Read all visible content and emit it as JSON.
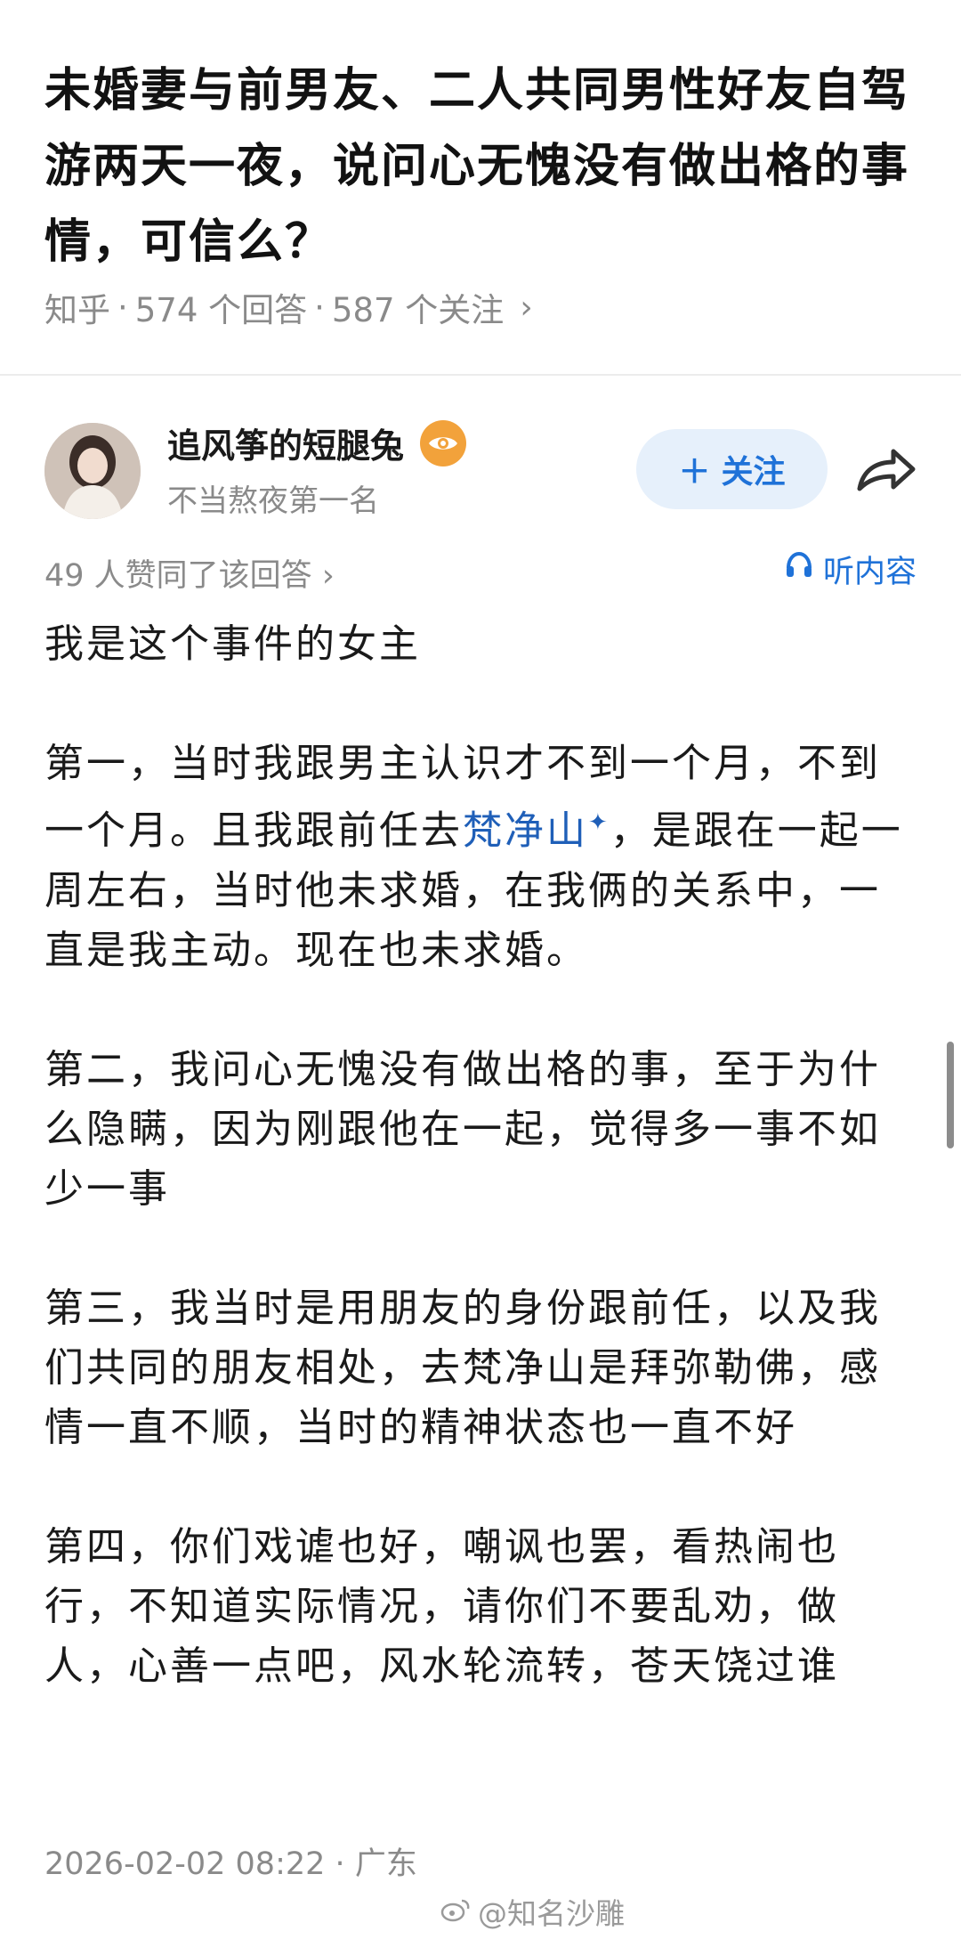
{
  "question": {
    "title": "未婚妻与前男友、二人共同男性好友自驾游两天一夜，说问心无愧没有做出格的事情，可信么？",
    "source": "知乎",
    "answer_count": "574 个回答",
    "follow_count": "587 个关注",
    "separator": "·"
  },
  "author": {
    "name": "追风筝的短腿兔",
    "bio": "不当熬夜第一名",
    "badge_icon": "eye-badge-icon",
    "follow_label": "关注"
  },
  "answer": {
    "votes": "49 人赞同了该回答",
    "listen_label": "听内容",
    "paragraphs": {
      "p1": "我是这个事件的女主",
      "p2_before": "第一，当时我跟男主认识才不到一个月，不到一个月。且我跟前任去",
      "p2_link": "梵净山",
      "p2_after": "，是跟在一起一周左右，当时他未求婚，在我俩的关系中，一直是我主动。现在也未求婚。",
      "p3": "第二，我问心无愧没有做出格的事，至于为什么隐瞒，因为刚跟他在一起，觉得多一事不如少一事",
      "p4": "第三，我当时是用朋友的身份跟前任，以及我们共同的朋友相处，去梵净山是拜弥勒佛，感情一直不顺，当时的精神状态也一直不好",
      "p5": "第四，你们戏谑也好，嘲讽也罢，看热闹也行，不知道实际情况，请你们不要乱劝，做人，心善一点吧，风水轮流转，苍天饶过谁"
    },
    "time": "2026-02-02 08:22",
    "location": "广东"
  },
  "watermark": "@知名沙雕",
  "colors": {
    "accent": "#1f72d8",
    "link": "#1f5fb8",
    "muted": "#8a8a8a",
    "follow_bg": "#e6f0fb",
    "badge": "#f2a23b"
  }
}
